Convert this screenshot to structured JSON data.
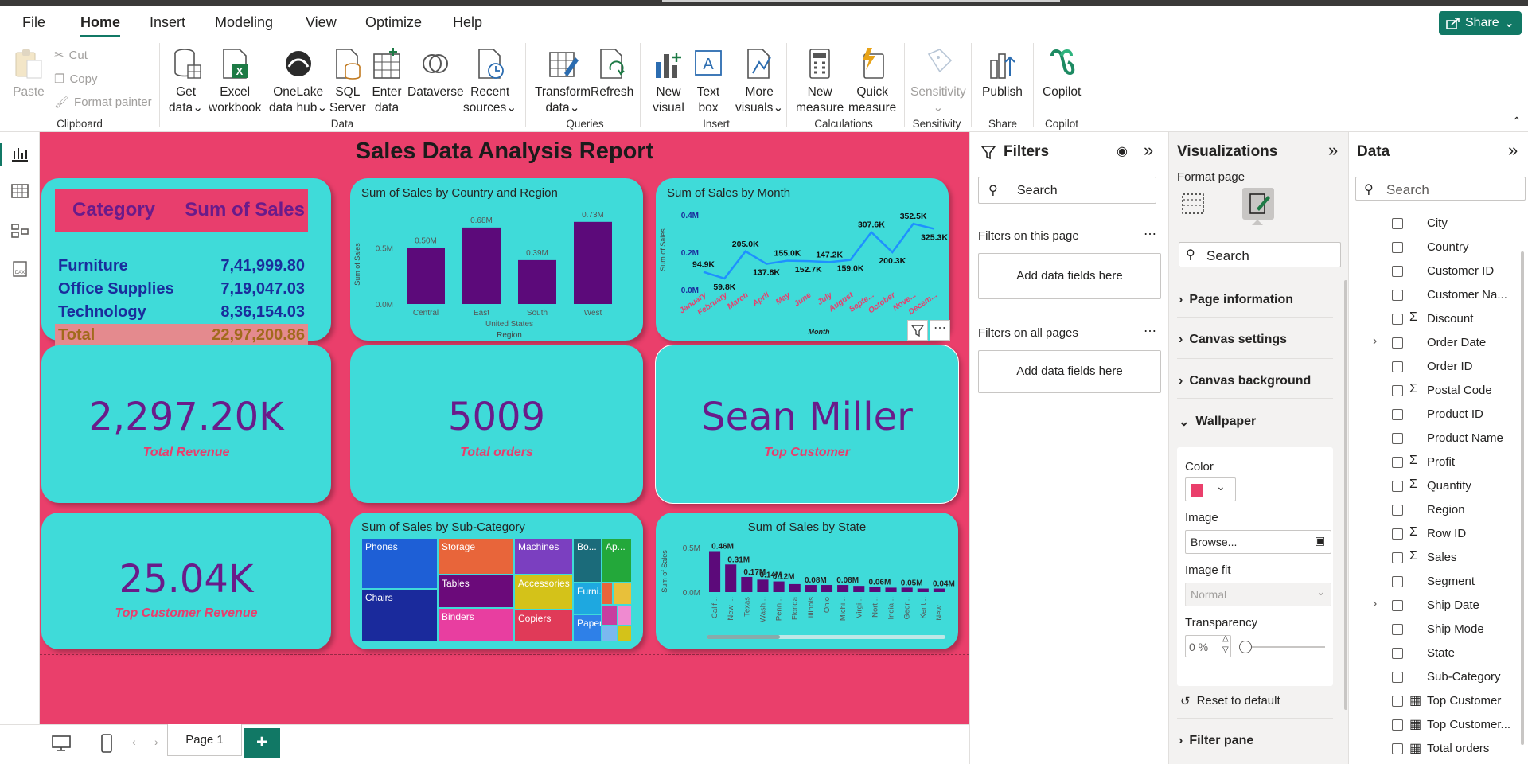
{
  "menu": {
    "items": [
      "File",
      "Home",
      "Insert",
      "Modeling",
      "View",
      "Optimize",
      "Help"
    ],
    "active": "Home",
    "share_label": "Share"
  },
  "ribbon": {
    "clipboard": {
      "paste": "Paste",
      "cut": "Cut",
      "copy": "Copy",
      "format_painter": "Format painter",
      "group": "Clipboard"
    },
    "data": {
      "get_data": [
        "Get",
        "data"
      ],
      "excel": [
        "Excel",
        "workbook"
      ],
      "onelake": [
        "OneLake",
        "data hub"
      ],
      "sql": [
        "SQL",
        "Server"
      ],
      "enter": [
        "Enter",
        "data"
      ],
      "dataverse": "Dataverse",
      "recent": [
        "Recent",
        "sources"
      ],
      "group": "Data"
    },
    "queries": {
      "transform": [
        "Transform",
        "data"
      ],
      "refresh": "Refresh",
      "group": "Queries"
    },
    "insert": {
      "new_visual": [
        "New",
        "visual"
      ],
      "text_box": [
        "Text",
        "box"
      ],
      "more_visuals": [
        "More",
        "visuals"
      ],
      "group": "Insert"
    },
    "calculations": {
      "new_measure": [
        "New",
        "measure"
      ],
      "quick_measure": [
        "Quick",
        "measure"
      ],
      "group": "Calculations"
    },
    "sensitivity": {
      "label": "Sensitivity",
      "group": "Sensitivity"
    },
    "share": {
      "publish": "Publish",
      "group": "Share"
    },
    "copilot": {
      "label": "Copilot",
      "group": "Copilot"
    }
  },
  "report": {
    "title": "Sales Data Analysis Report",
    "category_table": {
      "headers": [
        "Category",
        "Sum of Sales"
      ],
      "rows": [
        [
          "Furniture",
          "7,41,999.80"
        ],
        [
          "Office Supplies",
          "7,19,047.03"
        ],
        [
          "Technology",
          "8,36,154.03"
        ]
      ],
      "total": [
        "Total",
        "22,97,200.86"
      ]
    },
    "kpi_revenue": {
      "value": "2,297.20K",
      "label": "Total Revenue"
    },
    "kpi_orders": {
      "value": "5009",
      "label": "Total orders"
    },
    "kpi_customer": {
      "value": "Sean Miller",
      "label": "Top Customer"
    },
    "kpi_customer_revenue": {
      "value": "25.04K",
      "label": "Top Customer Revenue"
    }
  },
  "chart_data": [
    {
      "type": "bar",
      "title": "Sum of Sales by Country and Region",
      "categories": [
        "Central",
        "East",
        "South",
        "West"
      ],
      "values": [
        0.5,
        0.68,
        0.39,
        0.73
      ],
      "data_labels": [
        "0.50M",
        "0.68M",
        "0.39M",
        "0.73M"
      ],
      "ytick_labels": [
        "0.5M",
        "0.0M"
      ],
      "group_label": "United States",
      "xlabel": "Region",
      "ylabel": "Sum of Sales",
      "ylim": [
        0,
        0.75
      ],
      "color": "#5c0a7a"
    },
    {
      "type": "line",
      "title": "Sum of Sales by Month",
      "categories": [
        "January",
        "February",
        "March",
        "April",
        "May",
        "June",
        "July",
        "August",
        "Septe...",
        "October",
        "Nove...",
        "Decem..."
      ],
      "values": [
        94.9,
        59.8,
        205.0,
        137.8,
        155.0,
        152.7,
        147.2,
        159.0,
        307.6,
        200.3,
        352.5,
        325.3
      ],
      "data_labels": [
        "94.9K",
        "59.8K",
        "205.0K",
        "137.8K",
        "155.0K",
        "152.7K",
        "147.2K",
        "159.0K",
        "307.6K",
        "200.3K",
        "352.5K",
        "325.3K"
      ],
      "ytick_labels": [
        "0.4M",
        "0.2M",
        "0.0M"
      ],
      "xlabel": "Month",
      "ylabel": "Sum of Sales",
      "ylim": [
        0,
        400
      ],
      "color": "#1e90ff"
    },
    {
      "type": "treemap",
      "title": "Sum of Sales by Sub-Category",
      "categories": [
        "Phones",
        "Chairs",
        "Storage",
        "Tables",
        "Binders",
        "Machines",
        "Accessories",
        "Copiers",
        "Bo...",
        "Furni...",
        "Paper",
        "Ap..."
      ],
      "colors": [
        "#1e5fd6",
        "#1a2a9c",
        "#e8653a",
        "#6b0a7a",
        "#e83ea0",
        "#7b3fc0",
        "#d4c219",
        "#e03a58",
        "#1b6b7a",
        "#1ea8e0",
        "#2e80e8",
        "#23a83a"
      ]
    },
    {
      "type": "bar",
      "title": "Sum of Sales by State",
      "categories": [
        "Calif...",
        "New ...",
        "Texas",
        "Wash...",
        "Penn...",
        "Florida",
        "Illinois",
        "Ohio",
        "Michi...",
        "Virgi...",
        "Nort...",
        "India...",
        "Geor...",
        "Kent...",
        "New ..."
      ],
      "values": [
        0.46,
        0.31,
        0.17,
        0.14,
        0.12,
        0.09,
        0.08,
        0.08,
        0.08,
        0.07,
        0.06,
        0.05,
        0.05,
        0.04,
        0.04
      ],
      "data_labels": [
        "0.46M",
        "0.31M",
        "0.17M",
        "0.14M",
        "0.12M",
        "",
        "0.08M",
        "",
        "0.08M",
        "",
        "0.06M",
        "",
        "0.05M",
        "",
        "0.04M"
      ],
      "ytick_labels": [
        "0.5M",
        "0.0M"
      ],
      "ylabel": "Sum of Sales",
      "ylim": [
        0,
        0.5
      ],
      "color": "#5c0a7a"
    }
  ],
  "filters": {
    "title": "Filters",
    "search_placeholder": "Search",
    "this_page": "Filters on this page",
    "all_pages": "Filters on all pages",
    "add_fields": "Add data fields here"
  },
  "visualizations": {
    "title": "Visualizations",
    "format_page": "Format page",
    "search_placeholder": "Search",
    "sections": [
      "Page information",
      "Canvas settings",
      "Canvas background",
      "Wallpaper"
    ],
    "wallpaper": {
      "color_label": "Color",
      "color_value": "#ea3f6b",
      "image_label": "Image",
      "image_value": "Browse...",
      "image_fit_label": "Image fit",
      "image_fit_value": "Normal",
      "transparency_label": "Transparency",
      "transparency_value": "0 %",
      "reset": "Reset to default"
    },
    "filter_pane": "Filter pane"
  },
  "data_pane": {
    "title": "Data",
    "search_placeholder": "Search",
    "fields": [
      {
        "name": "City",
        "sigma": false,
        "calc": false,
        "expand": false
      },
      {
        "name": "Country",
        "sigma": false,
        "calc": false,
        "expand": false
      },
      {
        "name": "Customer ID",
        "sigma": false,
        "calc": false,
        "expand": false
      },
      {
        "name": "Customer Na...",
        "sigma": false,
        "calc": false,
        "expand": false
      },
      {
        "name": "Discount",
        "sigma": true,
        "calc": false,
        "expand": false
      },
      {
        "name": "Order Date",
        "sigma": false,
        "calc": false,
        "expand": true
      },
      {
        "name": "Order ID",
        "sigma": false,
        "calc": false,
        "expand": false
      },
      {
        "name": "Postal Code",
        "sigma": true,
        "calc": false,
        "expand": false
      },
      {
        "name": "Product ID",
        "sigma": false,
        "calc": false,
        "expand": false
      },
      {
        "name": "Product Name",
        "sigma": false,
        "calc": false,
        "expand": false
      },
      {
        "name": "Profit",
        "sigma": true,
        "calc": false,
        "expand": false
      },
      {
        "name": "Quantity",
        "sigma": true,
        "calc": false,
        "expand": false
      },
      {
        "name": "Region",
        "sigma": false,
        "calc": false,
        "expand": false
      },
      {
        "name": "Row ID",
        "sigma": true,
        "calc": false,
        "expand": false
      },
      {
        "name": "Sales",
        "sigma": true,
        "calc": false,
        "expand": false
      },
      {
        "name": "Segment",
        "sigma": false,
        "calc": false,
        "expand": false
      },
      {
        "name": "Ship Date",
        "sigma": false,
        "calc": false,
        "expand": true
      },
      {
        "name": "Ship Mode",
        "sigma": false,
        "calc": false,
        "expand": false
      },
      {
        "name": "State",
        "sigma": false,
        "calc": false,
        "expand": false
      },
      {
        "name": "Sub-Category",
        "sigma": false,
        "calc": false,
        "expand": false
      },
      {
        "name": "Top Customer",
        "sigma": false,
        "calc": true,
        "expand": false
      },
      {
        "name": "Top Customer...",
        "sigma": false,
        "calc": true,
        "expand": false
      },
      {
        "name": "Total orders",
        "sigma": false,
        "calc": true,
        "expand": false
      }
    ]
  },
  "pages": {
    "tabs": [
      "Page 1"
    ],
    "add_label": "+"
  },
  "colors": {
    "canvas": "#ea3f6b",
    "card": "#3fdbd9",
    "brand": "#117865",
    "kpi_text": "#6a1b8a"
  }
}
